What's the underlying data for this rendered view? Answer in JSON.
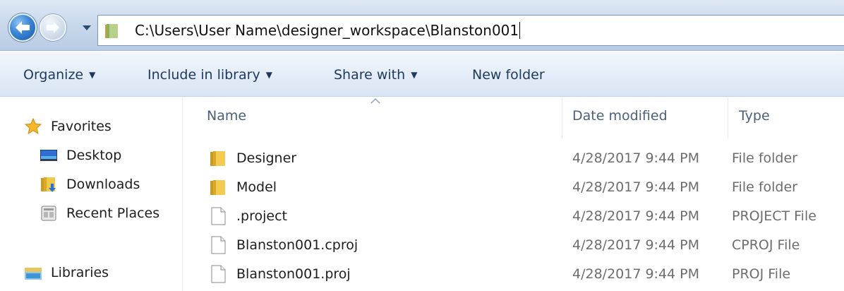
{
  "address_bar": {
    "path": "C:\\Users\\User Name\\designer_workspace\\Blanston001",
    "back_icon": "back-arrow-icon",
    "forward_icon": "forward-arrow-icon",
    "history_icon": "chevron-down-icon",
    "location_icon": "folder-icon"
  },
  "toolbar": {
    "organize": "Organize",
    "include_in_library": "Include in library",
    "share_with": "Share with",
    "new_folder": "New folder",
    "dropdown_glyph": "▼"
  },
  "nav_pane": {
    "favorites": {
      "label": "Favorites",
      "icon": "star-icon"
    },
    "items": [
      {
        "label": "Desktop",
        "icon": "desktop-icon"
      },
      {
        "label": "Downloads",
        "icon": "downloads-folder-icon"
      },
      {
        "label": "Recent Places",
        "icon": "recent-places-icon"
      }
    ],
    "libraries": {
      "label": "Libraries",
      "icon": "libraries-icon"
    }
  },
  "file_list": {
    "columns": {
      "name": "Name",
      "date": "Date modified",
      "type": "Type"
    },
    "sort": {
      "column": "name",
      "direction": "ascending"
    },
    "rows": [
      {
        "name": "Designer",
        "date": "4/28/2017 9:44 PM",
        "type": "File folder",
        "icon": "folder-icon"
      },
      {
        "name": "Model",
        "date": "4/28/2017 9:44 PM",
        "type": "File folder",
        "icon": "folder-icon"
      },
      {
        "name": ".project",
        "date": "4/28/2017 9:44 PM",
        "type": "PROJECT File",
        "icon": "file-icon"
      },
      {
        "name": "Blanston001.cproj",
        "date": "4/28/2017 9:44 PM",
        "type": "CPROJ File",
        "icon": "file-icon"
      },
      {
        "name": "Blanston001.proj",
        "date": "4/28/2017 9:44 PM",
        "type": "PROJ File",
        "icon": "file-icon"
      }
    ]
  },
  "colors": {
    "toolbar_text": "#1e395b",
    "header_text": "#4c607a",
    "secondary_text": "#6d6d6d",
    "folder": "#e8b83a"
  }
}
